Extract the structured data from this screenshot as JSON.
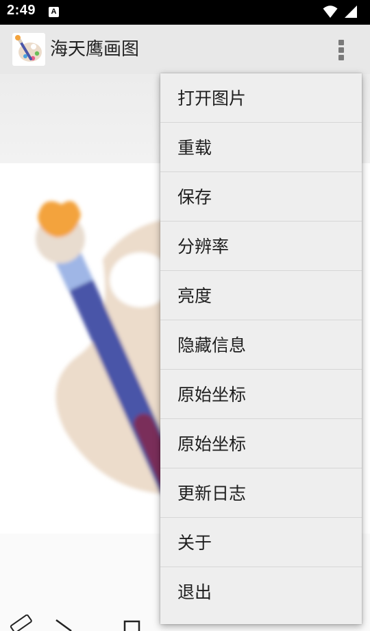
{
  "status_bar": {
    "time": "2:49",
    "notification_letter": "A"
  },
  "app_bar": {
    "title": "海天鹰画图",
    "app_icon": "palette-brush-icon",
    "overflow_icon": "more-vert-icon"
  },
  "menu": {
    "items": [
      {
        "label": "打开图片"
      },
      {
        "label": "重载"
      },
      {
        "label": "保存"
      },
      {
        "label": "分辨率"
      },
      {
        "label": "亮度"
      },
      {
        "label": "隐藏信息"
      },
      {
        "label": "原始坐标"
      },
      {
        "label": "原始坐标"
      },
      {
        "label": "更新日志"
      },
      {
        "label": "关于"
      },
      {
        "label": "退出"
      }
    ]
  },
  "bottom_tools": [
    "pencil-icon",
    "line-icon",
    "rectangle-icon",
    "oval-icon",
    "drop-icon",
    "fill-circle-icon"
  ],
  "colors": {
    "status_bar": "#000000",
    "app_bar": "#e8e8e8",
    "menu_background": "#eeeeee",
    "menu_divider": "#d6d6d6",
    "brush_handle": "#4a55a8",
    "brush_tip": "#f3a33c",
    "palette": "#ecdccb"
  }
}
